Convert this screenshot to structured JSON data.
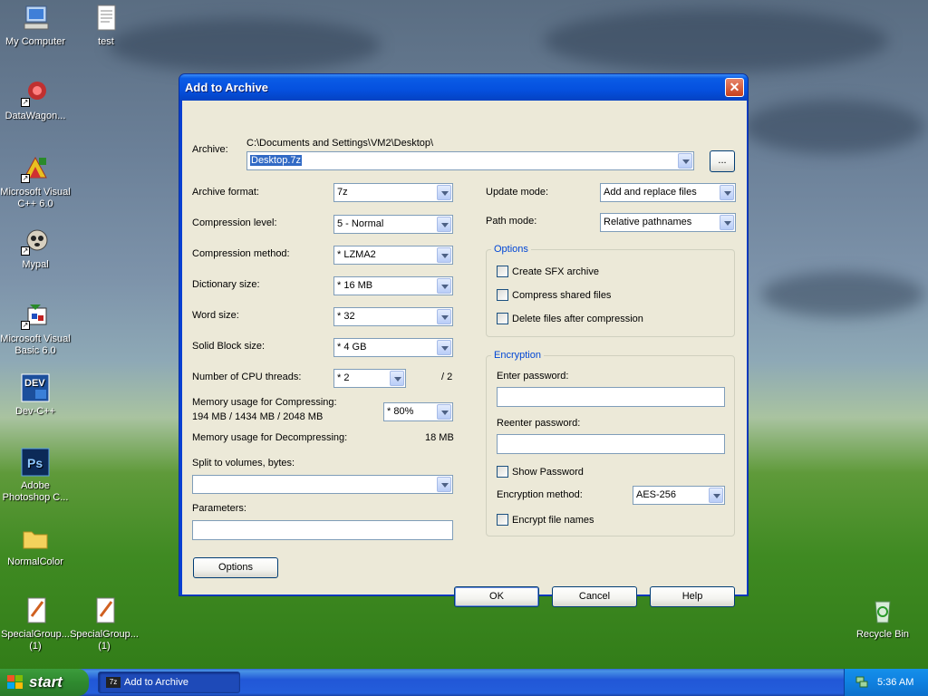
{
  "desktop": {
    "icons": [
      {
        "label": "My Computer"
      },
      {
        "label": "test"
      },
      {
        "label": "DataWagon..."
      },
      {
        "label": "Microsoft Visual C++ 6.0"
      },
      {
        "label": "Mypal"
      },
      {
        "label": "Microsoft Visual Basic 6.0"
      },
      {
        "label": "Dev-C++"
      },
      {
        "label": "Adobe Photoshop C..."
      },
      {
        "label": "NormalColor"
      },
      {
        "label": "SpecialGroup... (1)"
      },
      {
        "label": "SpecialGroup... (1)"
      },
      {
        "label": "Recycle Bin"
      }
    ]
  },
  "dialog": {
    "title": "Add to Archive",
    "close_glyph": "✕",
    "archive_label": "Archive:",
    "archive_path": "C:\\Documents and Settings\\VM2\\Desktop\\",
    "archive_name": "Desktop.7z",
    "browse_label": "...",
    "left": {
      "archive_format": {
        "label": "Archive format:",
        "value": "7z"
      },
      "compression_level": {
        "label": "Compression level:",
        "value": "5 - Normal"
      },
      "compression_method": {
        "label": "Compression method:",
        "value": "* LZMA2"
      },
      "dictionary_size": {
        "label": "Dictionary size:",
        "value": "* 16 MB"
      },
      "word_size": {
        "label": "Word size:",
        "value": "* 32"
      },
      "solid_block_size": {
        "label": "Solid Block size:",
        "value": "* 4 GB"
      },
      "cpu_threads": {
        "label": "Number of CPU threads:",
        "value": "* 2",
        "max": "/ 2"
      },
      "memory_compress": {
        "label": "Memory usage for Compressing:",
        "detail": "194 MB / 1434 MB / 2048 MB",
        "value": "* 80%"
      },
      "memory_decompress": {
        "label": "Memory usage for Decompressing:",
        "value": "18 MB"
      },
      "split_volumes": {
        "label": "Split to volumes, bytes:",
        "value": ""
      },
      "parameters": {
        "label": "Parameters:",
        "value": ""
      },
      "options_button": "Options"
    },
    "right": {
      "update_mode": {
        "label": "Update mode:",
        "value": "Add and replace files"
      },
      "path_mode": {
        "label": "Path mode:",
        "value": "Relative pathnames"
      },
      "options_group": {
        "title": "Options",
        "create_sfx": "Create SFX archive",
        "compress_shared": "Compress shared files",
        "delete_after": "Delete files after compression"
      },
      "encryption_group": {
        "title": "Encryption",
        "enter_password": "Enter password:",
        "reenter_password": "Reenter password:",
        "show_password": "Show Password",
        "method_label": "Encryption method:",
        "method_value": "AES-256",
        "encrypt_names": "Encrypt file names"
      }
    },
    "buttons": {
      "ok": "OK",
      "cancel": "Cancel",
      "help": "Help"
    }
  },
  "taskbar": {
    "start_label": "start",
    "task_label": "Add to Archive",
    "task_icon_text": "7z",
    "clock": "5:36 AM"
  },
  "colors": {
    "accent": "#0a5ce6",
    "group_title": "#0046d5",
    "selection": "#316ac5"
  }
}
